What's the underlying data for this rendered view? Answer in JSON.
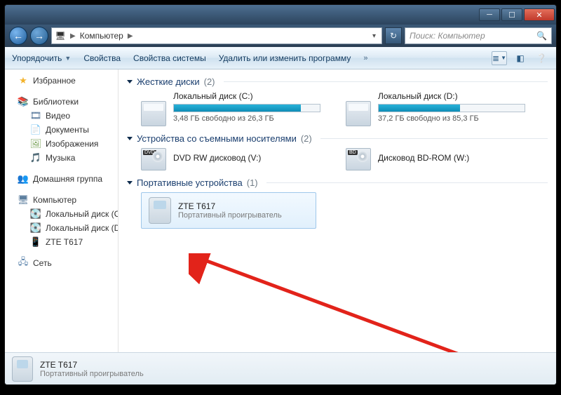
{
  "breadcrumb": {
    "root": "Компьютер"
  },
  "search": {
    "placeholder": "Поиск: Компьютер"
  },
  "toolbar": {
    "organize": "Упорядочить",
    "properties": "Свойства",
    "system_properties": "Свойства системы",
    "uninstall": "Удалить или изменить программу"
  },
  "sidebar": {
    "favorites": "Избранное",
    "libraries": "Библиотеки",
    "video": "Видео",
    "documents": "Документы",
    "images": "Изображения",
    "music": "Музыка",
    "homegroup": "Домашняя группа",
    "computer": "Компьютер",
    "local_c": "Локальный диск (C",
    "local_d": "Локальный диск (D",
    "zte": "ZTE T617",
    "network": "Сеть"
  },
  "categories": {
    "hdd": {
      "title": "Жесткие диски",
      "count": "(2)"
    },
    "removable": {
      "title": "Устройства со съемными носителями",
      "count": "(2)"
    },
    "portable": {
      "title": "Портативные устройства",
      "count": "(1)"
    }
  },
  "drives": {
    "c": {
      "title": "Локальный диск (C:)",
      "free": "3,48 ГБ свободно из 26,3 ГБ"
    },
    "d": {
      "title": "Локальный диск (D:)",
      "free": "37,2 ГБ свободно из 85,3 ГБ"
    }
  },
  "optical": {
    "dvd": {
      "title": "DVD RW дисковод (V:)",
      "badge": "DVD"
    },
    "bd": {
      "title": "Дисковод BD-ROM (W:)",
      "badge": "BD"
    }
  },
  "portable": {
    "title": "ZTE T617",
    "sub": "Портативный проигрыватель"
  },
  "status": {
    "title": "ZTE T617",
    "sub": "Портативный проигрыватель"
  }
}
